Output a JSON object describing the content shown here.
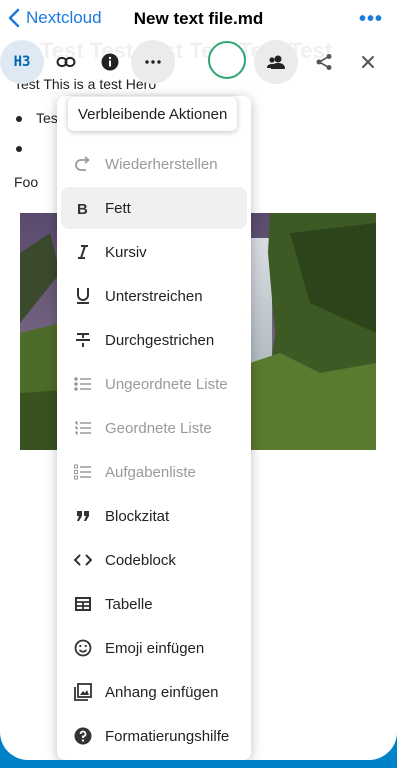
{
  "nav": {
    "back_label": "Nextcloud",
    "title": "New text file.md",
    "more_label": "•••"
  },
  "toolbar": {
    "heading_label": "H3"
  },
  "document": {
    "ghost_heading": "Test Test Test Test Test Test",
    "hero_line": "Test This is a test Hero",
    "bullet_1": "Tes",
    "bullet_2": "",
    "foo": "Foo",
    "caption": "..."
  },
  "menu": {
    "tooltip": "Verbleibende Aktionen",
    "items": [
      {
        "label": "Wiederherstellen",
        "icon": "redo-icon",
        "state": "disabled"
      },
      {
        "label": "Fett",
        "icon": "bold-icon",
        "state": "active"
      },
      {
        "label": "Kursiv",
        "icon": "italic-icon",
        "state": "normal"
      },
      {
        "label": "Unterstreichen",
        "icon": "underline-icon",
        "state": "normal"
      },
      {
        "label": "Durchgestrichen",
        "icon": "strikethrough-icon",
        "state": "normal"
      },
      {
        "label": "Ungeordnete Liste",
        "icon": "bullet-list-icon",
        "state": "disabled"
      },
      {
        "label": "Geordnete Liste",
        "icon": "numbered-list-icon",
        "state": "disabled"
      },
      {
        "label": "Aufgabenliste",
        "icon": "task-list-icon",
        "state": "disabled"
      },
      {
        "label": "Blockzitat",
        "icon": "quote-icon",
        "state": "normal"
      },
      {
        "label": "Codeblock",
        "icon": "code-icon",
        "state": "normal"
      },
      {
        "label": "Tabelle",
        "icon": "table-icon",
        "state": "normal"
      },
      {
        "label": "Emoji einfügen",
        "icon": "emoji-icon",
        "state": "normal"
      },
      {
        "label": "Anhang einfügen",
        "icon": "image-icon",
        "state": "normal"
      },
      {
        "label": "Formatierungshilfe",
        "icon": "help-icon",
        "state": "normal"
      }
    ]
  },
  "colors": {
    "accent": "#1a7ae0",
    "brand": "#0082c9",
    "avatar_ring": "#2aa86f"
  }
}
